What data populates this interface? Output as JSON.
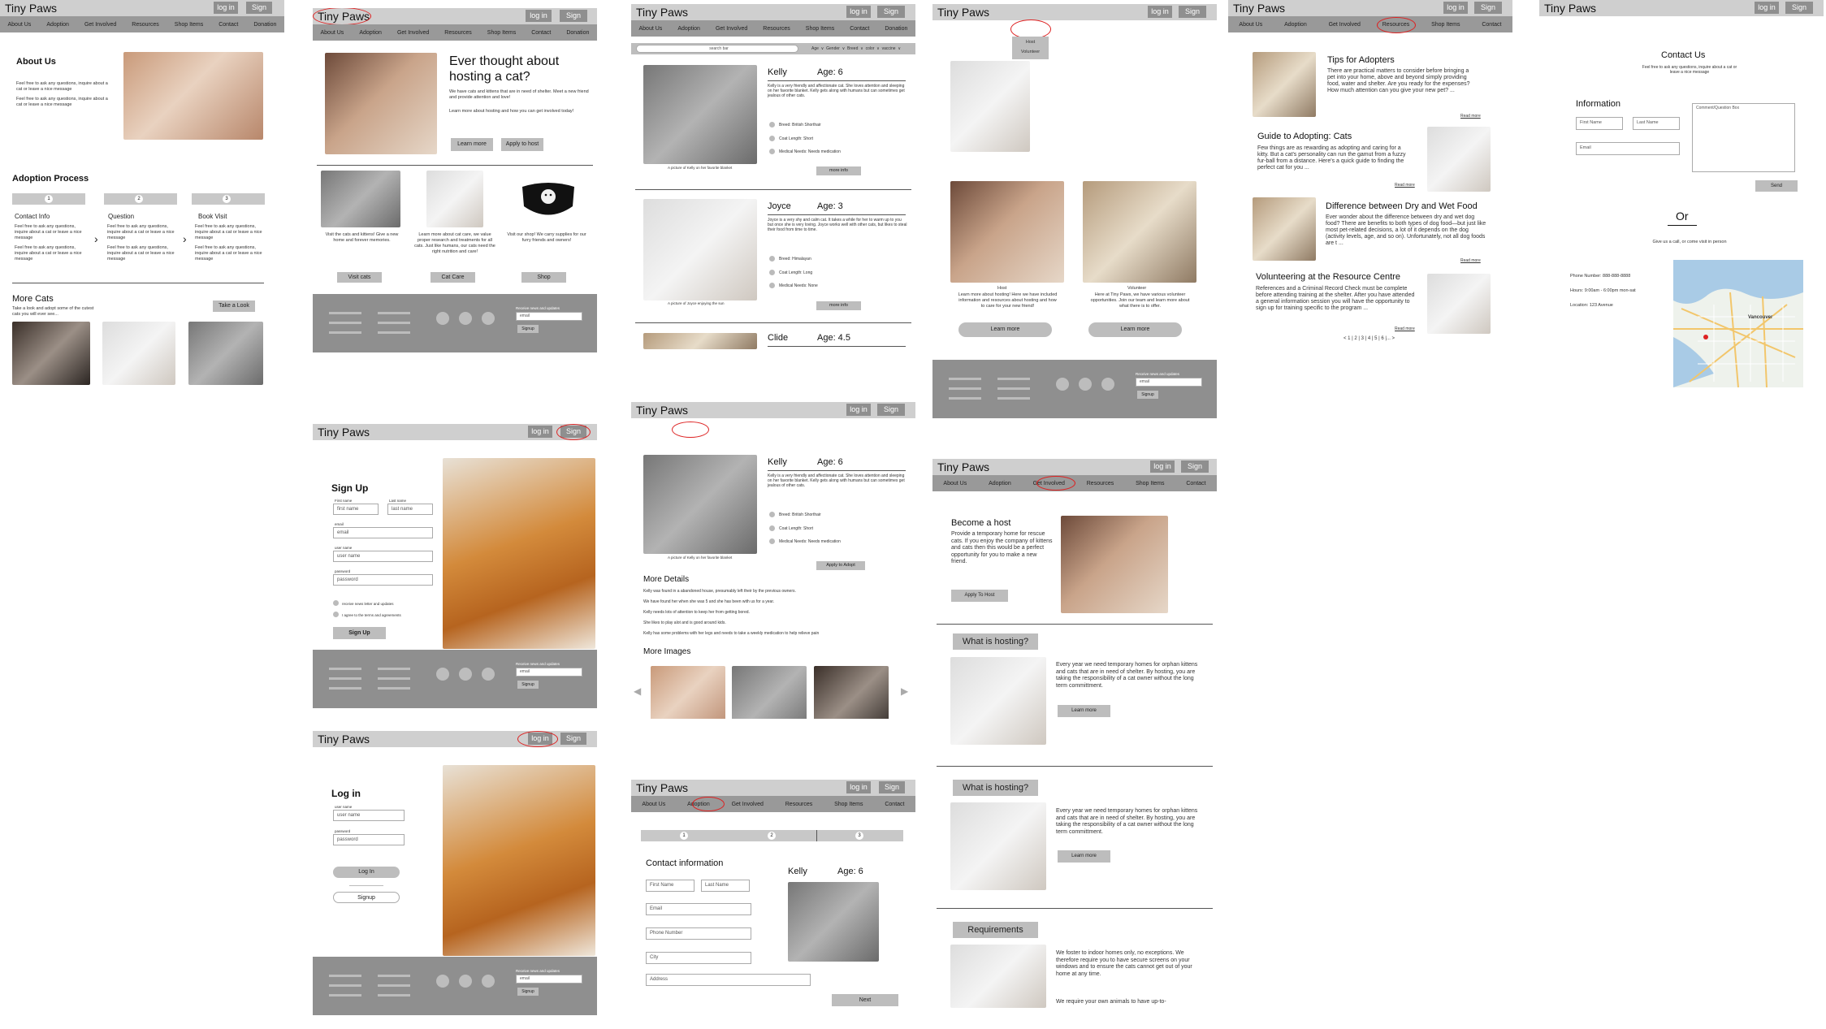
{
  "brand": "Tiny Paws",
  "header": {
    "login": "log in",
    "signup": "Sign up"
  },
  "nav": [
    "About Us",
    "Adoption",
    "Get Involved",
    "Resources",
    "Shop Items",
    "Contact",
    "Donation"
  ],
  "f1": {
    "about_title": "About Us",
    "about_text": "Feel free to ask any questions, inquire about a cat or leave a nice message",
    "process_title": "Adoption Process",
    "steps": [
      {
        "n": "1",
        "title": "Contact Info"
      },
      {
        "n": "2",
        "title": "Question"
      },
      {
        "n": "3",
        "title": "Book Visit"
      }
    ],
    "step_text": "Feel free to ask any questions, inquire about a cat or leave a nice message",
    "more_title": "More Cats",
    "more_text": "Take a look and adopt some of the cutest cats you will ever see...",
    "take_look": "Take a Look"
  },
  "f2": {
    "hero_title": "Ever thought about hosting a cat?",
    "hero_text": "We have cats and kittens that are in need of shelter. Meet a new friend and provide attention and love!",
    "hero_text2": "Learn more about hosting and how you can get involved today!",
    "learn_more": "Learn more",
    "apply_host": "Apply to host",
    "card1": "Visit the cats and kittens! Give a new home and forever memories.",
    "card2": "Learn more about cat care, we value proper research and treatments for all cats. Just like humans, our cats need the right nutrition and care!",
    "card3": "Visit our shop! We carry supplies for our furry friends and owners!",
    "btn1": "Visit cats",
    "btn2": "Cat Care",
    "btn3": "Shop",
    "email_label": "Receive news and updates",
    "email_ph": "email",
    "signup": "Signup"
  },
  "f3": {
    "title": "Sign Up",
    "first": "first name",
    "last": "last name",
    "email": "email",
    "user": "user name",
    "pass": "password",
    "first_lbl": "First name",
    "last_lbl": "Last name",
    "email_lbl": "email",
    "user_lbl": "user name",
    "pass_lbl": "password",
    "chk1": "receive news letter and updates",
    "chk2": "I agree to the terms and agreements",
    "btn": "Sign Up"
  },
  "f4": {
    "title": "Log in",
    "user": "user name",
    "pass": "password",
    "user_lbl": "user name",
    "pass_lbl": "password",
    "login": "Log In",
    "signup": "Signup"
  },
  "f5": {
    "search": "search bar",
    "filters": "Age  ∨  Gender  ∨  Breed  ∨  color  ∨  vaccine  ∨",
    "cats": [
      {
        "name": "Kelly",
        "age": "Age: 6",
        "desc": "Kelly is a very friendly and affectionate cat. She loves attention and sleeping on her favorite blanket. Kelly gets along with humans but can sometimes get jealous of other cats.",
        "breed": "Breed: British Shorthair",
        "coat": "Coat Length: Short",
        "med": "Medical Needs: Needs medication",
        "cap": "A picture of Kelly on her favorite blanket",
        "more": "more info"
      },
      {
        "name": "Joyce",
        "age": "Age: 3",
        "desc": "Joyce is a very shy and calm cat. It takes a while for her to warm up to you but once she is very loving. Joyce works well with other cats, but likes to steal their food from time to time.",
        "breed": "Breed: Himalayan",
        "coat": "Coat Length: Long",
        "med": "Medical Needs: None",
        "cap": "A picture of Joyce enjoying the sun",
        "more": "more info"
      },
      {
        "name": "Clide",
        "age": "Age: 4.5"
      }
    ]
  },
  "f6": {
    "name": "Kelly",
    "age": "Age: 6",
    "desc": "Kelly is a very friendly and affectionate cat. She loves attention and sleeping on her favorite blanket. Kelly gets along with humans but can sometimes get jealous of other cats.",
    "breed": "Breed: British Shorthair",
    "coat": "Coat Length: Short",
    "med": "Medical Needs: Needs medication",
    "cap": "A picture of Kelly on her favorite blanket",
    "apply": "Apply to Adopt",
    "details_title": "More Details",
    "details": [
      "Kelly was found in a abandoned house, presumably left their by the previous owners.",
      "We have found her when she was 5 and she has been with us for a year.",
      "Kelly needs lots of attention to keep her from getting bored.",
      "She likes to play alot and is good around kids.",
      "Kelly has some problems with her legs and needs to take a weekly medication to help relieve pain"
    ],
    "images_title": "More Images"
  },
  "f7": {
    "contact_title": "Contact information",
    "first": "First Name",
    "last": "Last Name",
    "email": "Email",
    "phone": "Phone Number",
    "city": "City",
    "address": "Address",
    "name": "Kelly",
    "age": "Age: 6",
    "next": "Next",
    "steps": [
      "1",
      "2",
      "3"
    ]
  },
  "f8": {
    "host": "Host",
    "volunteer": "Volunteer",
    "host_text": "Learn more about hosting! Here we have included information and resources about hosting and how to care for your new friend!",
    "vol_text": "Here at Tiny Paws, we have various volunteer opportunities. Join our team and learn more about what there is to offer.",
    "learn1": "Learn more",
    "learn2": "Learn more",
    "email_label": "Receive news and updates",
    "email_ph": "email",
    "signup": "Signup"
  },
  "f9": {
    "title": "Become a host",
    "text": "Provide a temporary home for rescue cats. If you enjoy the company of kittens and cats then this would be a perfect opportunity for you to make a new friend.",
    "apply": "Apply To Host",
    "s1_title": "What is hosting?",
    "s1_text": "Every year we need temporary homes for orphan kittens and cats that are in need of shelter. By hosting, you are taking the responsibility of a cat owner without the long term committment.",
    "s2_title": "What is hosting?",
    "s2_text": "Every year we need temporary homes for orphan kittens and cats that are in need of shelter. By hosting, you are taking the responsibility of a cat owner without the long term committment.",
    "learn": "Learn more",
    "s3_title": "Requirements",
    "s3_text": "We foster to indoor homes only, no exceptions. We therefore require you to have secure screens on your windows and to ensure the cats cannot get out of your home at any time.",
    "s3_text2": "We require your own animals to have up-to-"
  },
  "f10": {
    "articles": [
      {
        "title": "Tips for Adopters",
        "text": "There are practical matters to consider before bringing a pet into your home, above and beyond simply providing food, water and shelter. Are you ready for the expenses? How much attention can you give your new pet? ..."
      },
      {
        "title": "Guide to Adopting: Cats",
        "text": "Few things are as rewarding as adopting and caring for a kitty. But a cat's personality can run the gamut from a fuzzy fur-ball from a distance. Here's a quick guide to finding the perfect cat for you ..."
      },
      {
        "title": "Difference between Dry and Wet Food",
        "text": "Ever wonder about the difference between dry and wet dog food? There are benefits to both types of dog food—but just like most pet-related decisions, a lot of it depends on the dog (activity levels, age, and so on). Unfortunately, not all dog foods are t ..."
      },
      {
        "title": "Volunteering at the Resource Centre",
        "text": "References and a Criminal Record Check must be complete before attending training at the shelter. After you have attended a general information session you will have the opportunity to sign up for training specific to the program ..."
      }
    ],
    "read_more": "Read more",
    "pagination": "< 1 | 2 | 3 | 4 | 5 | 6 |... >"
  },
  "f11": {
    "title": "Contact Us",
    "sub": "Feel free to ask any questions, inquire about a cat or leave a nice message",
    "info": "Information",
    "first": "First Name",
    "last": "Last Name",
    "email": "Email",
    "comment": "Comment/Question Box",
    "send": "Send",
    "or": "Or",
    "or_text": "Give us a call, or come visit in person",
    "phone": "Phone Number: 888-888-8888",
    "hours": "Hours: 9:00am - 6:00pm mon-sat",
    "location": "Location: 123 Avenue",
    "map_city": "Vancouver"
  }
}
